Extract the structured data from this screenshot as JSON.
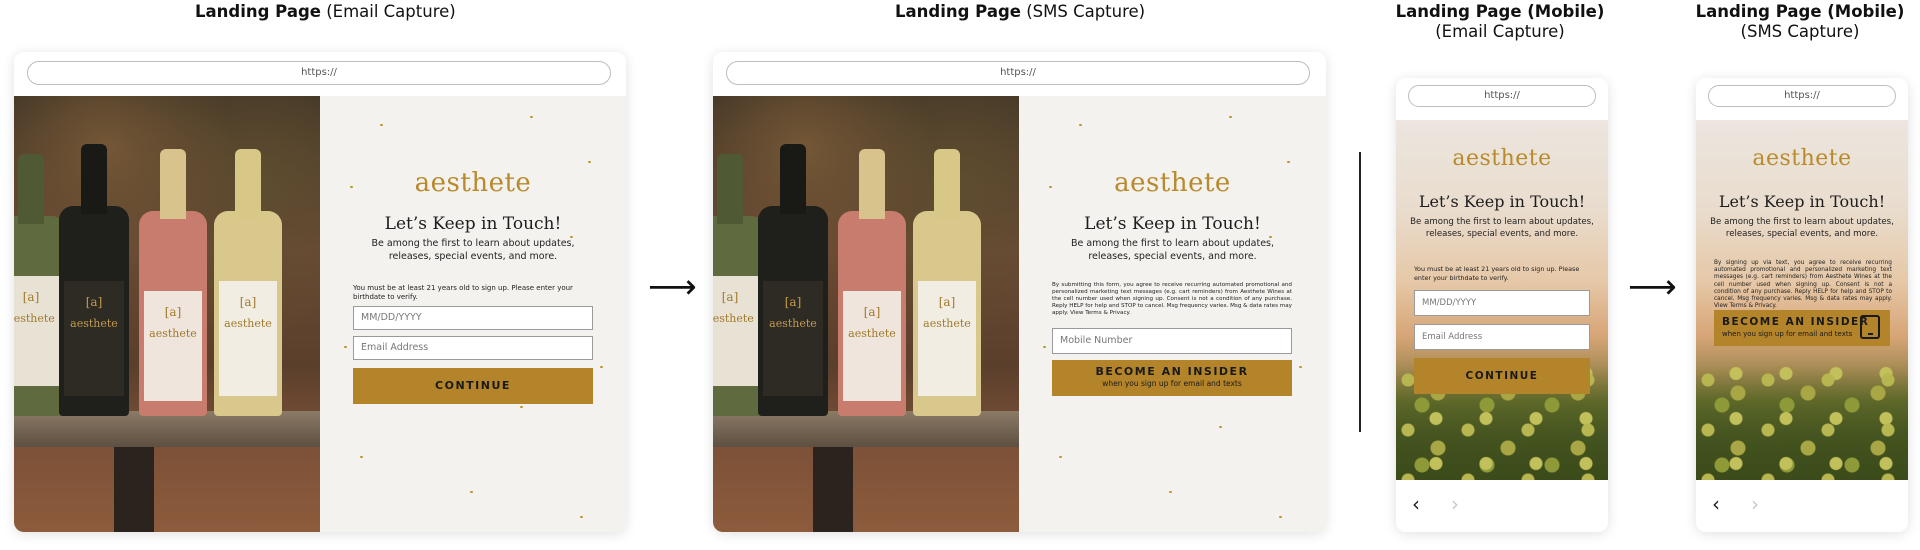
{
  "sections": {
    "desktop_email": {
      "title_bold": "Landing Page",
      "title_rest": "(Email Capture)"
    },
    "desktop_sms": {
      "title_bold": "Landing Page",
      "title_rest": "(SMS Capture)"
    },
    "mobile_email": {
      "title_bold": "Landing Page (Mobile)",
      "title_rest": "(Email Capture)"
    },
    "mobile_sms": {
      "title_bold": "Landing Page (Mobile)",
      "title_rest": "(SMS Capture)"
    }
  },
  "url": "https://",
  "brand": {
    "logo": "aesthete",
    "bottle_mark": "[a]",
    "color": "#b4842a"
  },
  "copy": {
    "heading": "Let’s Keep in Touch!",
    "sub_line1": "Be among the first to learn about updates,",
    "sub_line2": "releases, special events, and more."
  },
  "email_form": {
    "age_notice": "You must be at least 21 years old to sign up. Please enter your birthdate to verify.",
    "birthdate_placeholder": "MM/DD/YYYY",
    "email_placeholder": "Email Address",
    "continue_label": "CONTINUE"
  },
  "sms_form": {
    "consent_desktop": "By submitting this form, you agree to receive recurring automated promotional and personalized marketing text messages (e.g. cart reminders) from Aesthete Wines at the cell number used when signing up. Consent is not a condition of any purchase. Reply HELP for help and STOP to cancel. Msg frequency varies. Msg & data rates may apply. View Terms & Privacy.",
    "consent_mobile": "By signing up via text, you agree to receive recurring automated promotional and personalized marketing text messages (e.g. cart reminders) from Aesthete Wines at the cell number used when signing up. Consent is not a condition of any purchase. Reply HELP for help and STOP to cancel. Msg frequency varies. Msg & data rates may apply. View Terms & Privacy.",
    "mobile_placeholder": "Mobile Number",
    "insider_label": "BECOME AN INSIDER",
    "insider_sub": "when you sign up for email and texts"
  },
  "nav": {
    "back": "‹",
    "forward": "›"
  },
  "arrow": "⟶"
}
